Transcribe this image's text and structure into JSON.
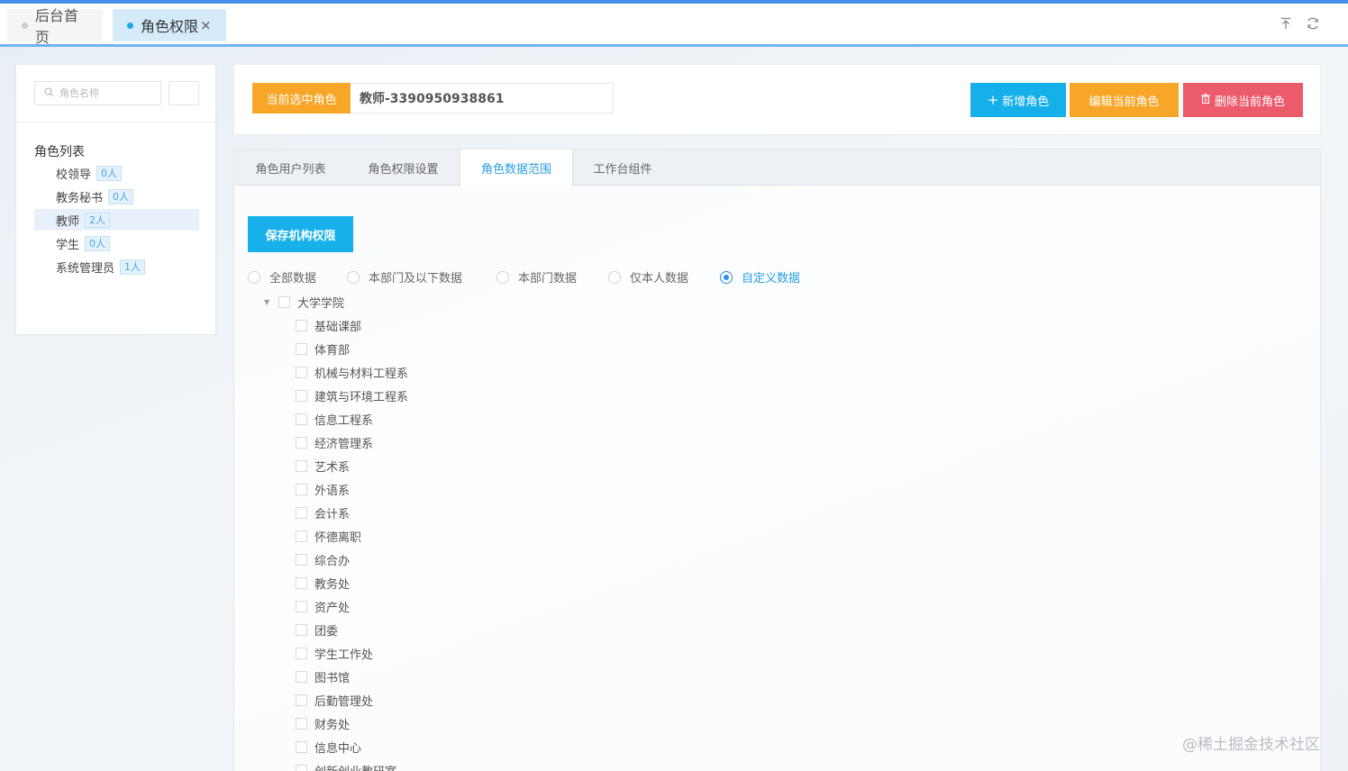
{
  "topbar": {
    "tabs": [
      {
        "label": "后台首页"
      },
      {
        "label": "角色权限"
      }
    ],
    "close_glyph": "×",
    "icons": [
      "upload-icon",
      "refresh-icon"
    ]
  },
  "sidebar": {
    "search_placeholder": "角色名称",
    "list_title": "角色列表",
    "roles": [
      {
        "name": "校领导",
        "count": "0人"
      },
      {
        "name": "教务秘书",
        "count": "0人"
      },
      {
        "name": "教师",
        "count": "2人"
      },
      {
        "name": "学生",
        "count": "0人"
      },
      {
        "name": "系统管理员",
        "count": "1人"
      }
    ]
  },
  "header": {
    "current_label": "当前选中角色",
    "current_value": "教师-3390950938861",
    "add_label": "新增角色",
    "edit_label": "编辑当前角色",
    "delete_label": "删除当前角色"
  },
  "panel": {
    "tabs": [
      "角色用户列表",
      "角色权限设置",
      "角色数据范围",
      "工作台组件"
    ],
    "active_tab": "角色数据范围",
    "save_label": "保存机构权限",
    "radios": [
      "全部数据",
      "本部门及以下数据",
      "本部门数据",
      "仅本人数据",
      "自定义数据"
    ],
    "selected_radio": "自定义数据",
    "tree_root": "大学学院",
    "tree_children": [
      "基础课部",
      "体育部",
      "机械与材料工程系",
      "建筑与环境工程系",
      "信息工程系",
      "经济管理系",
      "艺术系",
      "外语系",
      "会计系",
      "怀德离职",
      "综合办",
      "教务处",
      "资产处",
      "团委",
      "学生工作处",
      "图书馆",
      "后勤管理处",
      "财务处",
      "信息中心",
      "创新创业教研室"
    ]
  },
  "watermark": "@稀土掘金技术社区",
  "colors": {
    "primary": "#18b0ea",
    "warning": "#f7a627",
    "danger": "#ec5b6b",
    "accent": "#2a9ee4"
  }
}
